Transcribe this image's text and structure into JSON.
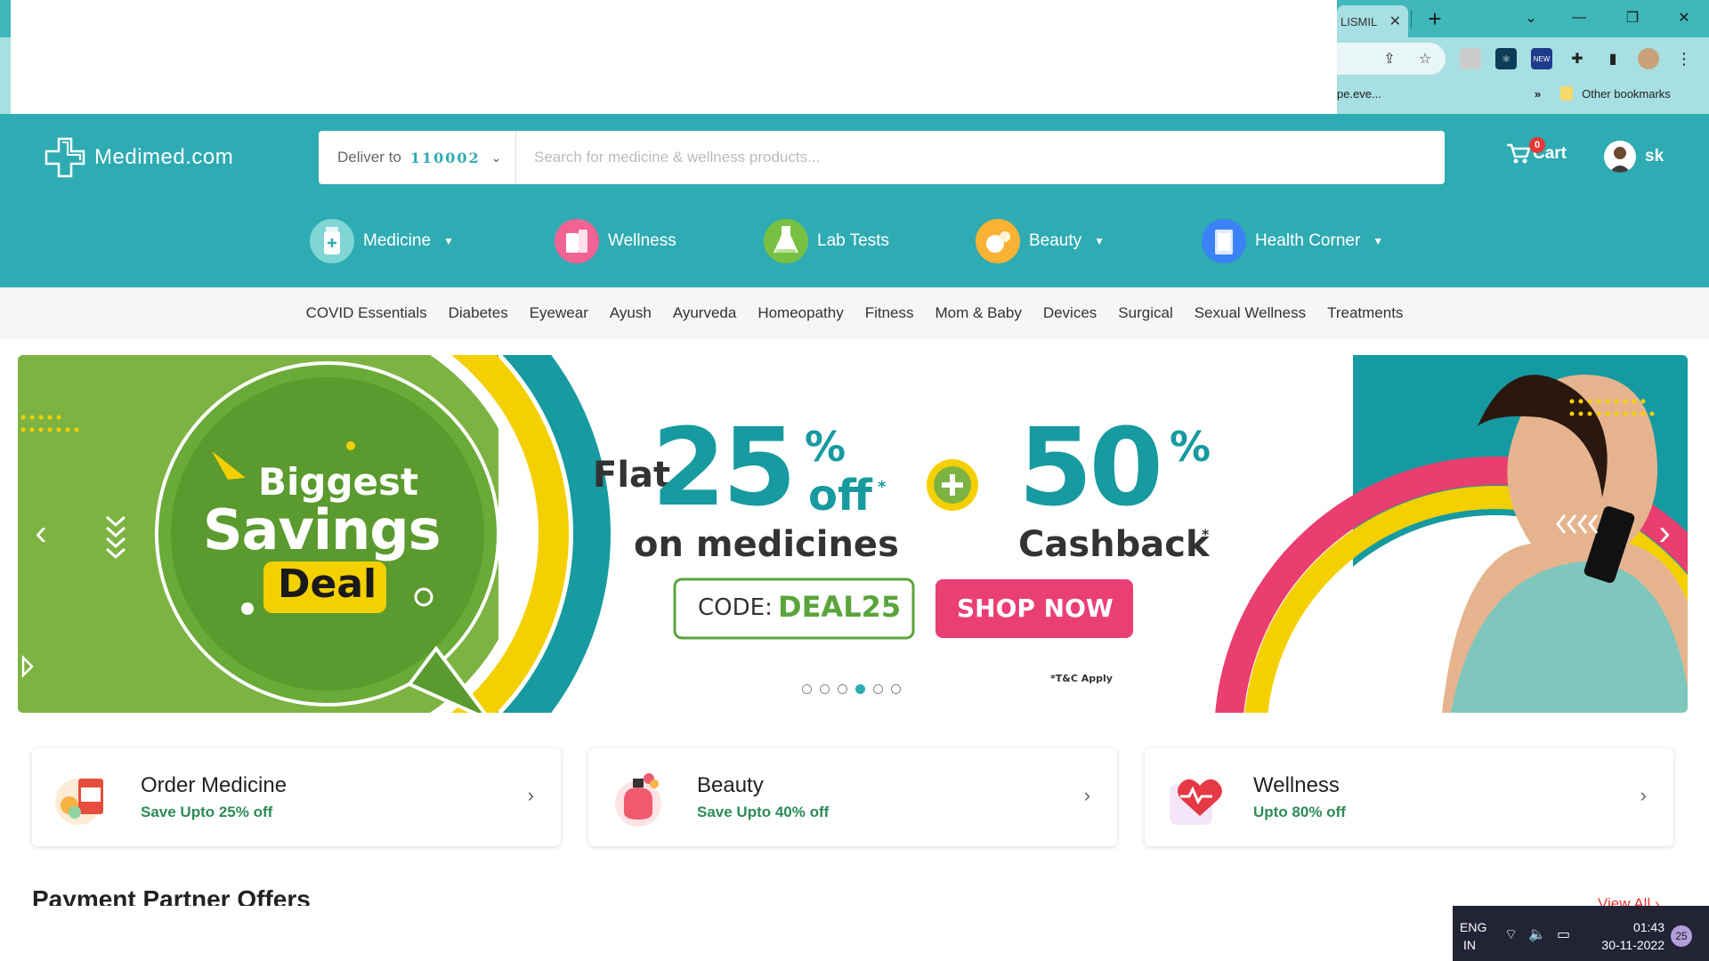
{
  "browser": {
    "tab_fragment": "LISMIL",
    "bookmark_fragment": "pe.eve...",
    "bookmarks_overflow": "»",
    "other_bookmarks": "Other bookmarks",
    "extension_new_label": "NEW"
  },
  "header": {
    "logo_text": "Medimed.com",
    "deliver_label": "Deliver to",
    "pincode": "110002",
    "search_placeholder": "Search for medicine & wellness products...",
    "cart_label": "Cart",
    "cart_count": "0",
    "user_name": "sk"
  },
  "main_nav": [
    {
      "label": "Medicine",
      "has_dropdown": true
    },
    {
      "label": "Wellness",
      "has_dropdown": false
    },
    {
      "label": "Lab Tests",
      "has_dropdown": false
    },
    {
      "label": "Beauty",
      "has_dropdown": true
    },
    {
      "label": "Health Corner",
      "has_dropdown": true
    }
  ],
  "sub_nav": [
    "COVID Essentials",
    "Diabetes",
    "Eyewear",
    "Ayush",
    "Ayurveda",
    "Homeopathy",
    "Fitness",
    "Mom & Baby",
    "Devices",
    "Surgical",
    "Sexual Wellness",
    "Treatments"
  ],
  "banner": {
    "badge_line1": "Biggest",
    "badge_line2": "Savings",
    "badge_line3": "Deal",
    "flat": "Flat",
    "discount_number": "25",
    "discount_percent": "%",
    "discount_off": "off",
    "asterisk": "*",
    "on_medicines": "on medicines",
    "plus": "+",
    "cashback_number": "50",
    "cashback_percent": "%",
    "cashback_label": "Cashback",
    "code_label": "CODE:",
    "code_value": "DEAL25",
    "shop_now": "SHOP NOW",
    "tc": "*T&C Apply",
    "slide_count": 6,
    "active_slide": 4
  },
  "cards": [
    {
      "title": "Order Medicine",
      "subtitle": "Save Upto 25% off"
    },
    {
      "title": "Beauty",
      "subtitle": "Save Upto 40% off"
    },
    {
      "title": "Wellness",
      "subtitle": "Upto 80% off"
    }
  ],
  "section": {
    "title": "Payment Partner Offers",
    "view_all": "View All ›"
  },
  "taskbar": {
    "lang_line1": "ENG",
    "lang_line2": "IN",
    "time": "01:43",
    "date": "30-11-2022",
    "notification_count": "25"
  },
  "colors": {
    "brand_teal": "#2fabb3",
    "banner_green": "#6aaa38",
    "banner_yellow": "#f5d000",
    "shop_pink": "#ea3f74",
    "code_green": "#5aa43c",
    "offer_green": "#2e8b57"
  }
}
